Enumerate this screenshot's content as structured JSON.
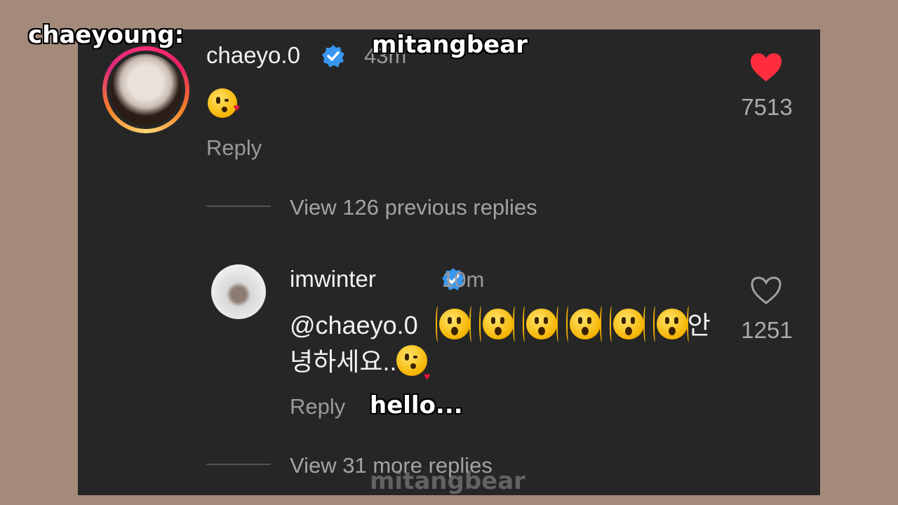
{
  "overlays": {
    "top_left_label": "chaeyoung:",
    "watermark_top": "mitangbear",
    "subtitle": "hello...",
    "watermark_bottom": "mitangbear"
  },
  "colors": {
    "background": "#a48a7b",
    "panel": "#262626",
    "liked_heart": "#ff2d3d",
    "verified": "#3897f0"
  },
  "comment": {
    "username": "chaeyo.0",
    "verified": true,
    "time": "43m",
    "emoji": "kissing-face-emoji",
    "reply_label": "Reply",
    "liked": true,
    "likes": "7513"
  },
  "view_previous": "View 126 previous replies",
  "reply": {
    "username": "imwinter",
    "verified": true,
    "time": "10m",
    "mention": "@chaeyo.0",
    "emojis": [
      "shaking-face-emoji",
      "shaking-face-emoji",
      "shaking-face-emoji",
      "shaking-face-emoji",
      "shaking-face-emoji",
      "shaking-face-emoji"
    ],
    "text_line1_tail": "안",
    "text_line2": "녕하세요..",
    "reply_label": "Reply",
    "liked": false,
    "likes": "1251"
  },
  "view_more": "View 31 more replies"
}
